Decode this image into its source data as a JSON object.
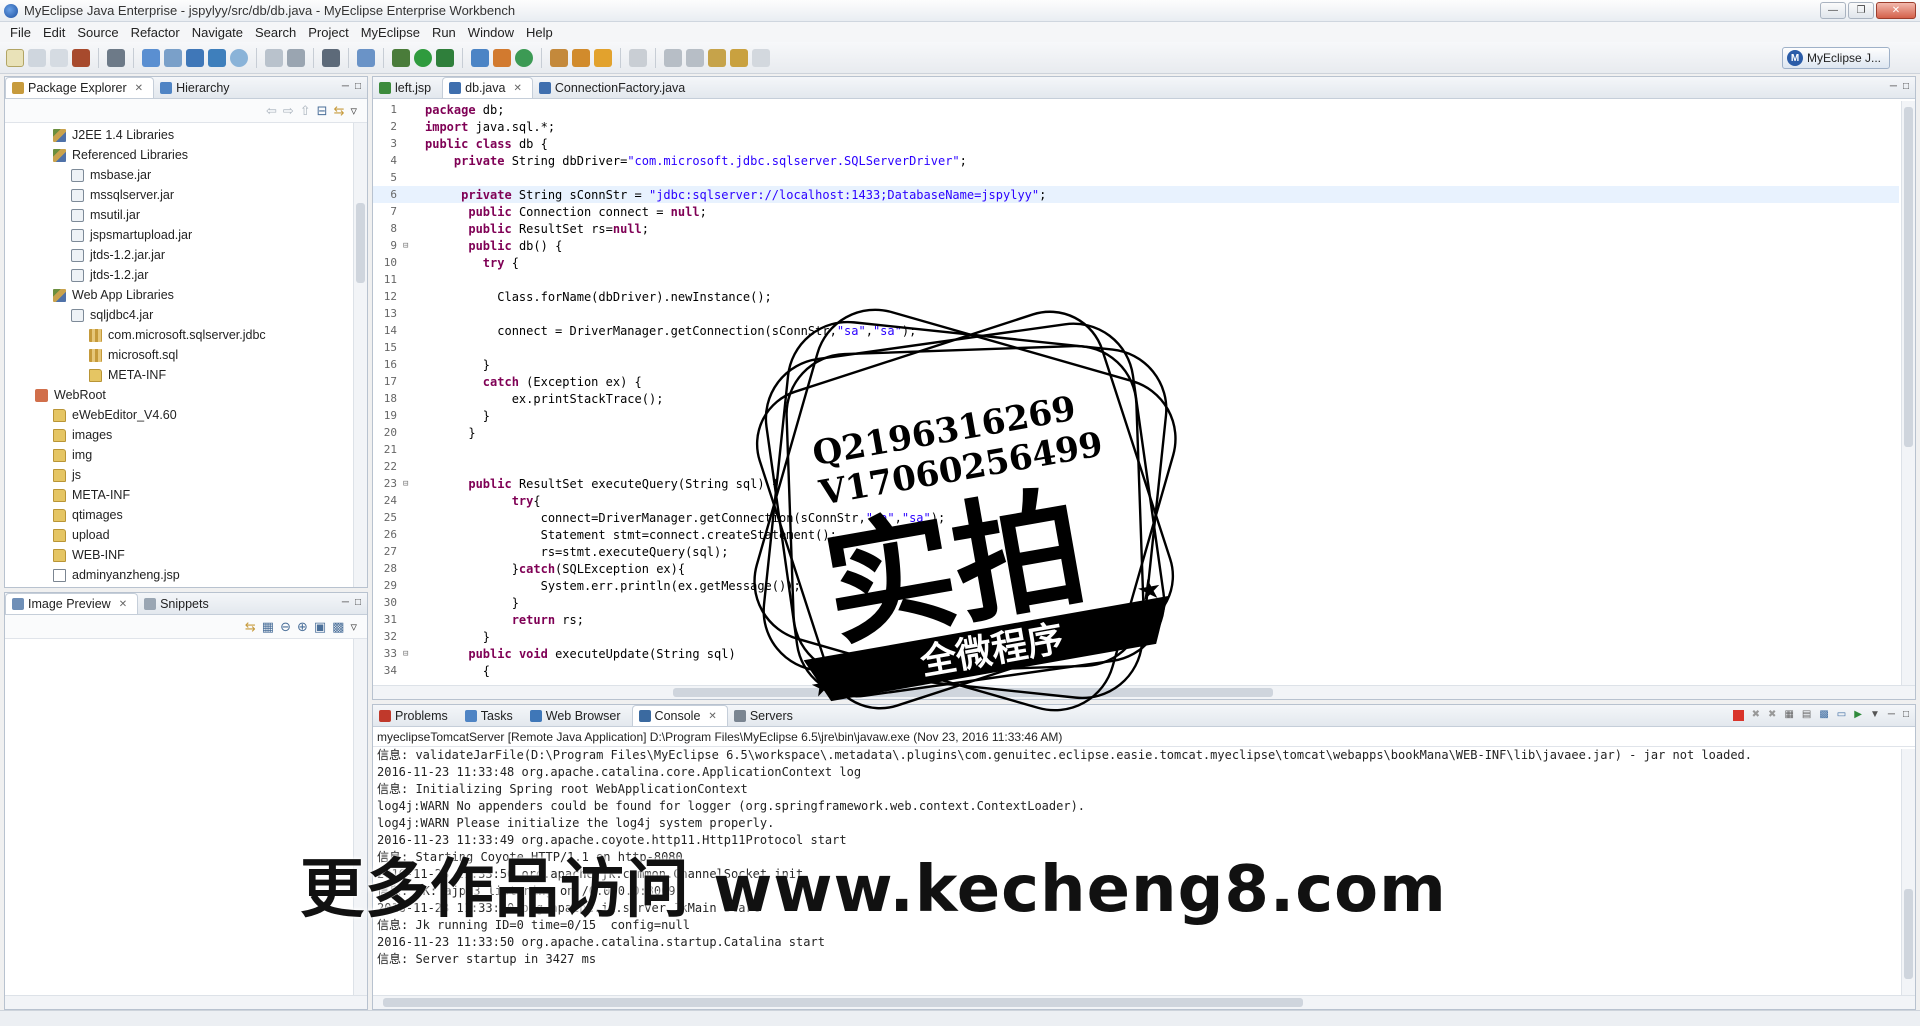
{
  "window": {
    "title": "MyEclipse Java Enterprise - jspylyy/src/db/db.java - MyEclipse Enterprise Workbench"
  },
  "menu": [
    "File",
    "Edit",
    "Source",
    "Refactor",
    "Navigate",
    "Search",
    "Project",
    "MyEclipse",
    "Run",
    "Window",
    "Help"
  ],
  "perspective": {
    "label": "MyEclipse J..."
  },
  "package_explorer": {
    "tabs": [
      "Package Explorer",
      "Hierarchy"
    ],
    "items": [
      {
        "label": "J2EE 1.4 Libraries",
        "icon": "library-icon",
        "indent": 1
      },
      {
        "label": "Referenced Libraries",
        "icon": "library-icon",
        "indent": 1
      },
      {
        "label": "msbase.jar",
        "icon": "jar-icon",
        "indent": 2
      },
      {
        "label": "mssqlserver.jar",
        "icon": "jar-icon",
        "indent": 2
      },
      {
        "label": "msutil.jar",
        "icon": "jar-icon",
        "indent": 2
      },
      {
        "label": "jspsmartupload.jar",
        "icon": "jar-icon",
        "indent": 2
      },
      {
        "label": "jtds-1.2.jar.jar",
        "icon": "jar-icon",
        "indent": 2
      },
      {
        "label": "jtds-1.2.jar",
        "icon": "jar-icon",
        "indent": 2
      },
      {
        "label": "Web App Libraries",
        "icon": "library-icon",
        "indent": 1
      },
      {
        "label": "sqljdbc4.jar",
        "icon": "jar-icon",
        "indent": 2
      },
      {
        "label": "com.microsoft.sqlserver.jdbc",
        "icon": "package-icon",
        "indent": 3
      },
      {
        "label": "microsoft.sql",
        "icon": "package-icon",
        "indent": 3
      },
      {
        "label": "META-INF",
        "icon": "folder-icon",
        "indent": 3
      },
      {
        "label": "WebRoot",
        "icon": "webroot-icon",
        "indent": 0
      },
      {
        "label": "eWebEditor_V4.60",
        "icon": "folder-icon",
        "indent": 1
      },
      {
        "label": "images",
        "icon": "folder-icon",
        "indent": 1
      },
      {
        "label": "img",
        "icon": "folder-icon",
        "indent": 1
      },
      {
        "label": "js",
        "icon": "folder-icon",
        "indent": 1
      },
      {
        "label": "META-INF",
        "icon": "folder-icon",
        "indent": 1
      },
      {
        "label": "qtimages",
        "icon": "folder-icon",
        "indent": 1
      },
      {
        "label": "upload",
        "icon": "folder-icon",
        "indent": 1
      },
      {
        "label": "WEB-INF",
        "icon": "folder-icon",
        "indent": 1
      },
      {
        "label": "adminyanzheng.jsp",
        "icon": "jsp-file-icon",
        "indent": 1
      }
    ]
  },
  "image_preview": {
    "tabs": [
      "Image Preview",
      "Snippets"
    ]
  },
  "editor": {
    "tabs": [
      "left.jsp",
      "db.java",
      "ConnectionFactory.java"
    ],
    "active_tab": 1,
    "highlight_line": 6,
    "lines": [
      {
        "n": "1",
        "t": "package db;"
      },
      {
        "n": "2",
        "t": "import java.sql.*;"
      },
      {
        "n": "3",
        "t": "public class db {"
      },
      {
        "n": "4",
        "t": "    private String dbDriver=\"com.microsoft.jdbc.sqlserver.SQLServerDriver\";"
      },
      {
        "n": "5",
        "t": ""
      },
      {
        "n": "6",
        "t": "     private String sConnStr = \"jdbc:sqlserver://localhost:1433;DatabaseName=jspylyy\";"
      },
      {
        "n": "7",
        "t": "      public Connection connect = null;"
      },
      {
        "n": "8",
        "t": "      public ResultSet rs=null;"
      },
      {
        "n": "9",
        "t": "      public db() {"
      },
      {
        "n": "10",
        "t": "        try {"
      },
      {
        "n": "11",
        "t": ""
      },
      {
        "n": "12",
        "t": "          Class.forName(dbDriver).newInstance();"
      },
      {
        "n": "13",
        "t": ""
      },
      {
        "n": "14",
        "t": "          connect = DriverManager.getConnection(sConnStr,\"sa\",\"sa\");"
      },
      {
        "n": "15",
        "t": ""
      },
      {
        "n": "16",
        "t": "        }"
      },
      {
        "n": "17",
        "t": "        catch (Exception ex) {"
      },
      {
        "n": "18",
        "t": "            ex.printStackTrace();"
      },
      {
        "n": "19",
        "t": "        }"
      },
      {
        "n": "20",
        "t": "      }"
      },
      {
        "n": "21",
        "t": ""
      },
      {
        "n": "22",
        "t": ""
      },
      {
        "n": "23",
        "t": "      public ResultSet executeQuery(String sql) {"
      },
      {
        "n": "24",
        "t": "            try{"
      },
      {
        "n": "25",
        "t": "                connect=DriverManager.getConnection(sConnStr,\"sa\",\"sa\");"
      },
      {
        "n": "26",
        "t": "                Statement stmt=connect.createStatement();"
      },
      {
        "n": "27",
        "t": "                rs=stmt.executeQuery(sql);"
      },
      {
        "n": "28",
        "t": "            }catch(SQLException ex){"
      },
      {
        "n": "29",
        "t": "                System.err.println(ex.getMessage());"
      },
      {
        "n": "30",
        "t": "            }"
      },
      {
        "n": "31",
        "t": "            return rs;"
      },
      {
        "n": "32",
        "t": "        }"
      },
      {
        "n": "33",
        "t": "      public void executeUpdate(String sql)"
      },
      {
        "n": "34",
        "t": "        {"
      }
    ]
  },
  "bottom_panel": {
    "tabs": [
      "Problems",
      "Tasks",
      "Web Browser",
      "Console",
      "Servers"
    ],
    "active_tab": 3,
    "console_title": "myeclipseTomcatServer [Remote Java Application] D:\\Program Files\\MyEclipse 6.5\\jre\\bin\\javaw.exe (Nov 23, 2016 11:33:46 AM)",
    "lines": [
      "信息: validateJarFile(D:\\Program Files\\MyEclipse 6.5\\workspace\\.metadata\\.plugins\\com.genuitec.eclipse.easie.tomcat.myeclipse\\tomcat\\webapps\\bookMana\\WEB-INF\\lib\\javaee.jar) - jar not loaded.",
      "2016-11-23 11:33:48 org.apache.catalina.core.ApplicationContext log",
      "信息: Initializing Spring root WebApplicationContext",
      "log4j:WARN No appenders could be found for logger (org.springframework.web.context.ContextLoader).",
      "log4j:WARN Please initialize the log4j system properly.",
      "2016-11-23 11:33:49 org.apache.coyote.http11.Http11Protocol start",
      "信息: Starting Coyote HTTP/1.1 on http-8080",
      "2016-11-23 11:33:50 org.apache.jk.common.ChannelSocket init",
      "信息: JK: ajp13 listening on /0.0.0.0:8009",
      "2016-11-23 11:33:50 org.apache.jk.server.JkMain start",
      "信息: Jk running ID=0 time=0/15  config=null",
      "2016-11-23 11:33:50 org.apache.catalina.startup.Catalina start",
      "信息: Server startup in 3427 ms"
    ]
  },
  "stamp": {
    "line1": "Q2196316269",
    "line2": "V17060256499",
    "big": "实拍",
    "banner": "全微程序"
  },
  "watermark": {
    "text": "更多作品访问 www.kecheng8.com"
  },
  "colors": {
    "keyword": "#7f0055",
    "string": "#2a00ff",
    "highlight": "#e8f2fe",
    "stop_button": "#d9342b"
  }
}
